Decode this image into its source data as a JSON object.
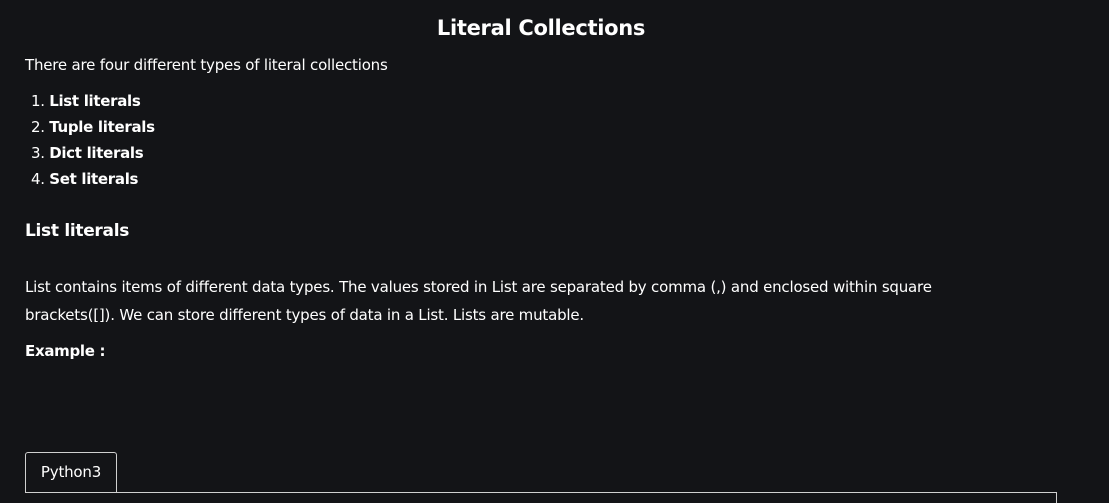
{
  "page": {
    "title": "Literal Collections",
    "intro": "There are four different types of literal collections",
    "types": [
      {
        "number": "1.",
        "label": "List literals"
      },
      {
        "number": "2.",
        "label": "Tuple literals"
      },
      {
        "number": "3.",
        "label": "Dict literals"
      },
      {
        "number": "4.",
        "label": "Set literals"
      }
    ]
  },
  "section": {
    "heading": "List literals",
    "description": "List contains items of different data types. The values stored in List are separated by comma (,) and enclosed within square brackets([]). We can store different types of data in a List. Lists are mutable.",
    "example_label": "Example :"
  },
  "code": {
    "tabs": [
      "Python3"
    ]
  },
  "colors": {
    "background": "#131417",
    "text": "#ffffff",
    "border": "#d0d0d0"
  }
}
